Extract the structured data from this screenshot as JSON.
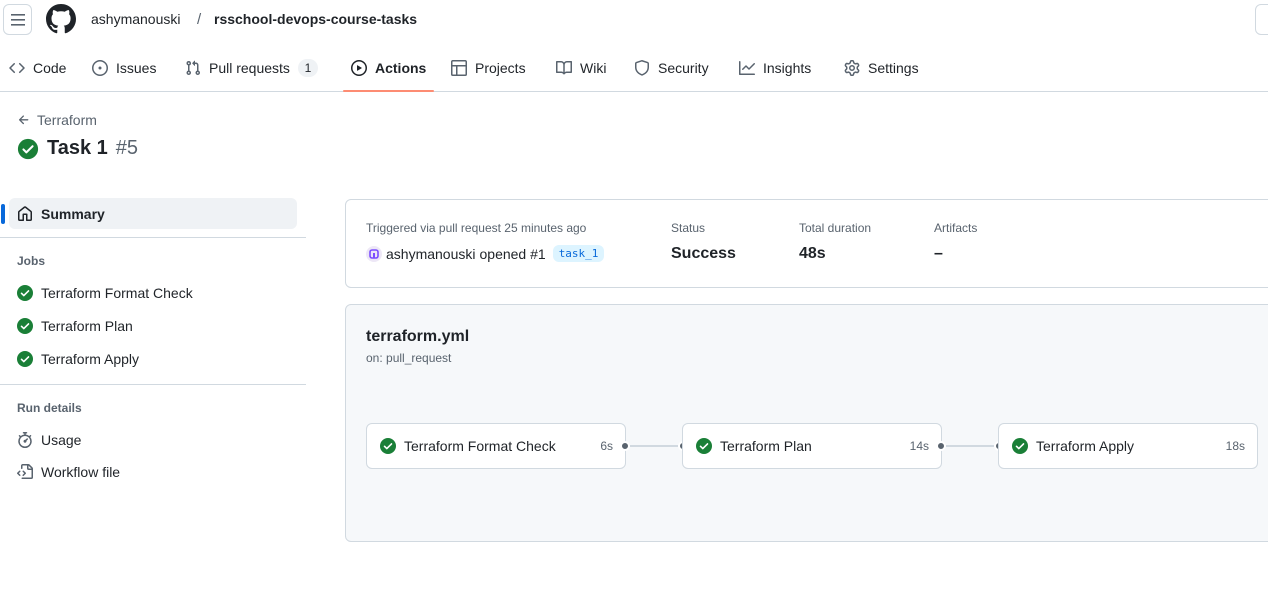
{
  "header": {
    "owner": "ashymanouski",
    "separator": "/",
    "repo": "rsschool-devops-course-tasks"
  },
  "nav": {
    "tabs": [
      {
        "label": "Code",
        "icon": "code-icon"
      },
      {
        "label": "Issues",
        "icon": "issue-icon"
      },
      {
        "label": "Pull requests",
        "icon": "pull-request-icon",
        "count": "1"
      },
      {
        "label": "Actions",
        "icon": "play-icon",
        "active": true
      },
      {
        "label": "Projects",
        "icon": "table-icon"
      },
      {
        "label": "Wiki",
        "icon": "book-icon"
      },
      {
        "label": "Security",
        "icon": "shield-icon"
      },
      {
        "label": "Insights",
        "icon": "graph-icon"
      },
      {
        "label": "Settings",
        "icon": "gear-icon"
      }
    ],
    "active_underline_color": "#fd8c73"
  },
  "run": {
    "back_label": "Terraform",
    "title": "Task 1",
    "number": "#5",
    "status_color": "#1a7f37"
  },
  "sidebar": {
    "summary_label": "Summary",
    "jobs_heading": "Jobs",
    "jobs": [
      {
        "label": "Terraform Format Check"
      },
      {
        "label": "Terraform Plan"
      },
      {
        "label": "Terraform Apply"
      }
    ],
    "run_details_heading": "Run details",
    "details": [
      {
        "label": "Usage",
        "icon": "stopwatch-icon"
      },
      {
        "label": "Workflow file",
        "icon": "file-code-icon"
      }
    ]
  },
  "summary": {
    "trigger_label": "Triggered via pull request 25 minutes ago",
    "actor": "ashymanouski",
    "action_text": "opened #1",
    "branch": "task_1",
    "status_label": "Status",
    "status_value": "Success",
    "duration_label": "Total duration",
    "duration_value": "48s",
    "artifacts_label": "Artifacts",
    "artifacts_value": "–"
  },
  "workflow": {
    "file": "terraform.yml",
    "on": "on: pull_request",
    "jobs": [
      {
        "label": "Terraform Format Check",
        "duration": "6s"
      },
      {
        "label": "Terraform Plan",
        "duration": "14s"
      },
      {
        "label": "Terraform Apply",
        "duration": "18s"
      }
    ]
  }
}
